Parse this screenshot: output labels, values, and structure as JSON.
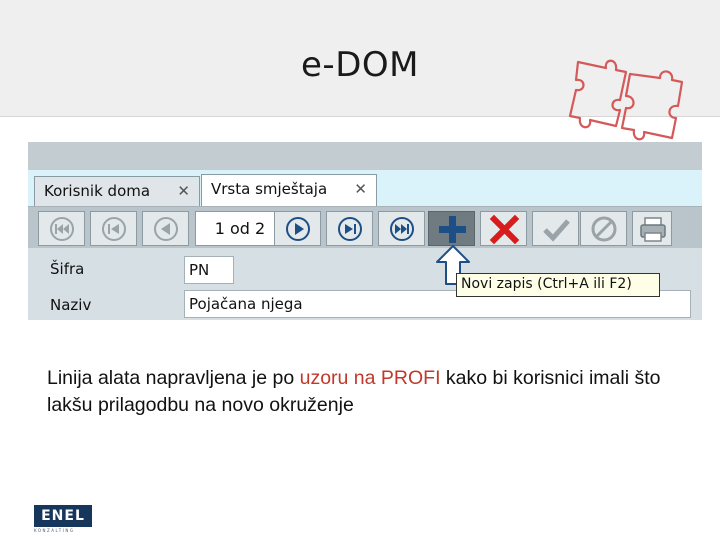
{
  "slide": {
    "title": "e-DOM"
  },
  "tabs": [
    {
      "label": "Korisnik doma",
      "close_glyph": "✕",
      "active": false
    },
    {
      "label": "Vrsta smještaja",
      "close_glyph": "✕",
      "active": true
    }
  ],
  "toolbar": {
    "buttons": [
      {
        "name": "first-record",
        "icon": "skip-first-icon"
      },
      {
        "name": "previous-page",
        "icon": "skip-previous-icon"
      },
      {
        "name": "previous-record",
        "icon": "triangle-left-icon"
      },
      {
        "name": "next-record",
        "icon": "play-icon"
      },
      {
        "name": "next-page",
        "icon": "skip-next-icon"
      },
      {
        "name": "last-record",
        "icon": "skip-last-icon"
      },
      {
        "name": "new-record",
        "icon": "plus-icon"
      },
      {
        "name": "delete-record",
        "icon": "cross-icon"
      },
      {
        "name": "confirm",
        "icon": "checkmark-icon"
      },
      {
        "name": "cancel",
        "icon": "prohibited-icon"
      },
      {
        "name": "print",
        "icon": "printer-icon"
      }
    ],
    "record_counter": "1 od 2"
  },
  "tooltip": {
    "text": "Novi zapis (Ctrl+A ili F2)"
  },
  "form": {
    "sifra": {
      "label": "Šifra",
      "value": "PN"
    },
    "naziv": {
      "label": "Naziv",
      "value": "Pojačana njega"
    }
  },
  "caption": {
    "part1": "Linija alata napravljena je po ",
    "highlight": "uzoru na PROFI",
    "part2": " kako bi korisnici imali što lakšu prilagodbu na novo okruženje"
  },
  "logo": {
    "text": "ENEL",
    "subtext": "KONZALTING"
  },
  "colors": {
    "header_bg": "#efefef",
    "tabstrip_bg": "#daf3fb",
    "toolbar_bg": "#b9c5cb",
    "new_button_bg": "#6f7b81",
    "play_icon": "#1d4f86",
    "delete_icon": "#d81b1b",
    "disabled_icon": "#9aa3a8",
    "caption_highlight": "#c0392b",
    "puzzle_stroke": "#d45a5a",
    "logo_bg": "#16365c"
  }
}
